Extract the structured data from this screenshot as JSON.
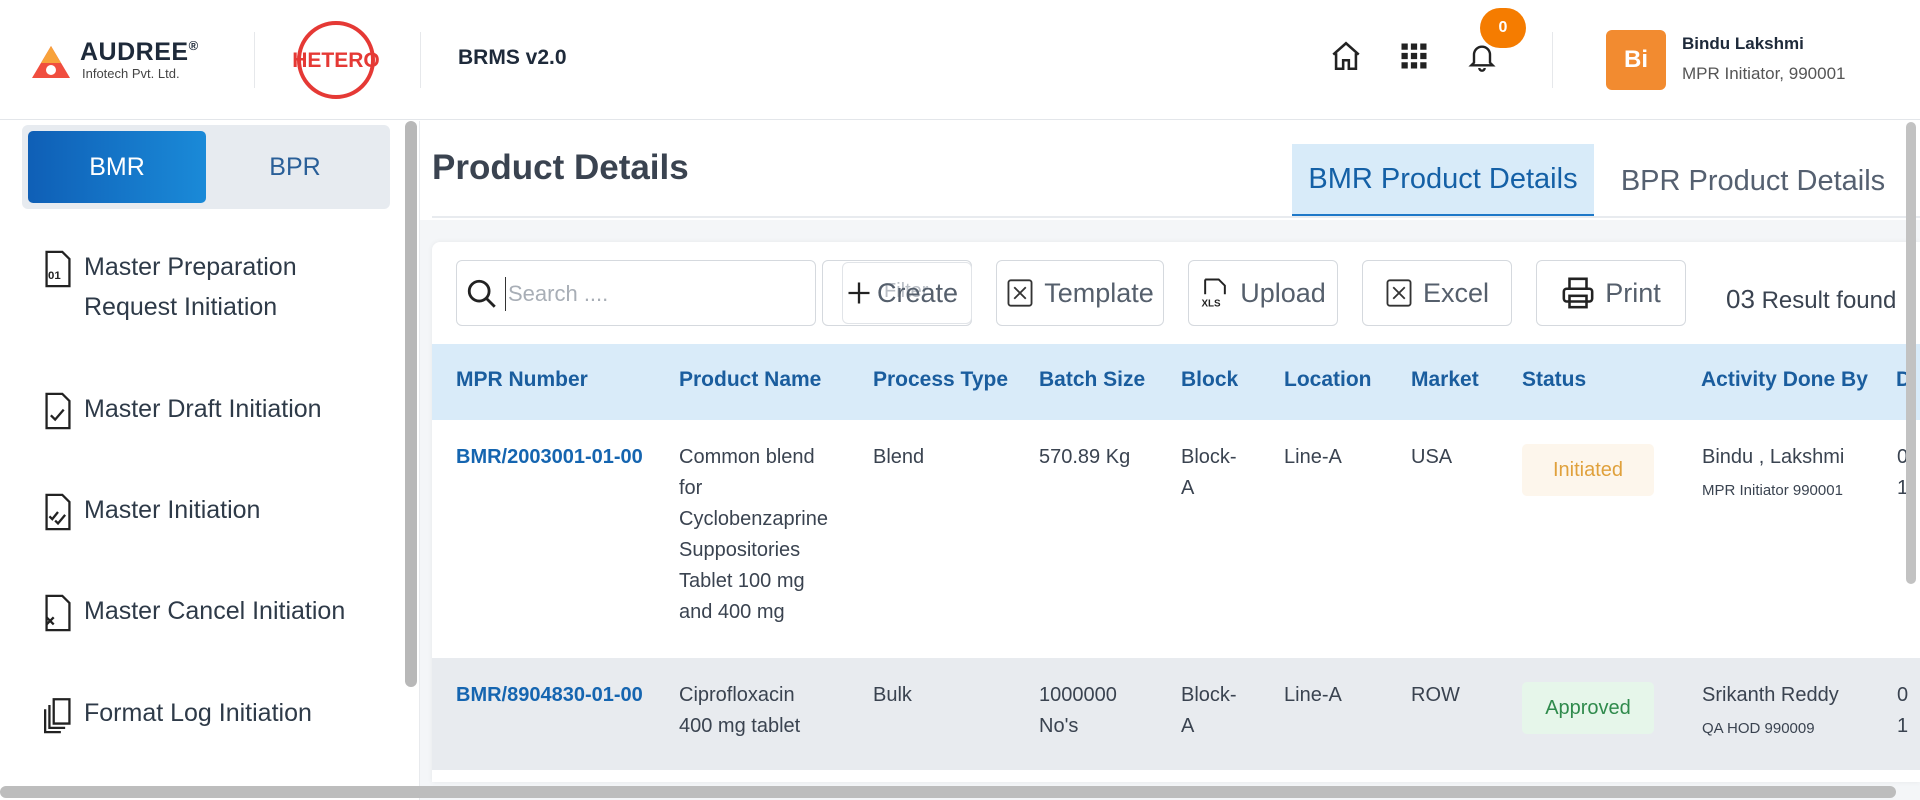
{
  "header": {
    "company_name": "AUDREE",
    "company_reg": "®",
    "company_sub": "Infotech Pvt. Ltd.",
    "partner_logo": "HETERO",
    "app_title": "BRMS v2.0",
    "icons": [
      "home-icon",
      "apps-grid-icon",
      "bell-icon"
    ],
    "notification_count": "0",
    "user": {
      "initials": "Bi",
      "name": "Bindu Lakshmi",
      "role": "MPR Initiator, 990001"
    },
    "colors": {
      "accent": "#f57c00",
      "avatar": "#f28b30"
    }
  },
  "sidebar": {
    "toggle": {
      "active": "BMR",
      "inactive": "BPR"
    },
    "items": [
      {
        "label": "Master Preparation",
        "label2": "Request Initiation",
        "icon": "document-01-icon"
      },
      {
        "label": "Master Draft Initiation",
        "icon": "document-check-icon"
      },
      {
        "label": "Master Initiation",
        "icon": "document-double-check-icon"
      },
      {
        "label": "Master Cancel Initiation",
        "icon": "document-cancel-icon"
      },
      {
        "label": "Format Log Initiation",
        "icon": "copy-documents-icon"
      }
    ]
  },
  "main": {
    "title": "Product Details",
    "tabs": [
      {
        "label": "BMR Product Details",
        "active": true
      },
      {
        "label": "BPR Product Details",
        "active": false
      }
    ],
    "toolbar": {
      "search_placeholder": "Search ....",
      "filter_label": "Filter",
      "create_label": "Create",
      "template_label": "Template",
      "upload_label": "Upload",
      "excel_label": "Excel",
      "print_label": "Print",
      "result_count": "03",
      "result_text": "Result found"
    },
    "table": {
      "columns": [
        "MPR Number",
        "Product Name",
        "Process Type",
        "Batch Size",
        "Block",
        "Location",
        "Market",
        "Status",
        "Activity Done By",
        "D"
      ],
      "rows": [
        {
          "mpr": "BMR/2003001-01-00",
          "product": [
            "Common blend",
            "for",
            "Cyclobenzaprine",
            "Suppositories",
            "Tablet 100 mg",
            "and 400 mg"
          ],
          "process": "Blend",
          "batch": [
            "570.89 Kg"
          ],
          "block": [
            "Block-",
            "A"
          ],
          "location": "Line-A",
          "market": "USA",
          "status": "Initiated",
          "by_name": "Bindu , Lakshmi",
          "by_role": "MPR Initiator 990001",
          "d": [
            "0",
            "1"
          ]
        },
        {
          "mpr": "BMR/8904830-01-00",
          "product": [
            "Ciprofloxacin",
            "400 mg tablet"
          ],
          "process": "Bulk",
          "batch": [
            "1000000",
            "No's"
          ],
          "block": [
            "Block-",
            "A"
          ],
          "location": "Line-A",
          "market": "ROW",
          "status": "Approved",
          "by_name": "Srikanth Reddy",
          "by_role": "QA HOD 990009",
          "d": [
            "0",
            "1"
          ]
        }
      ]
    }
  }
}
